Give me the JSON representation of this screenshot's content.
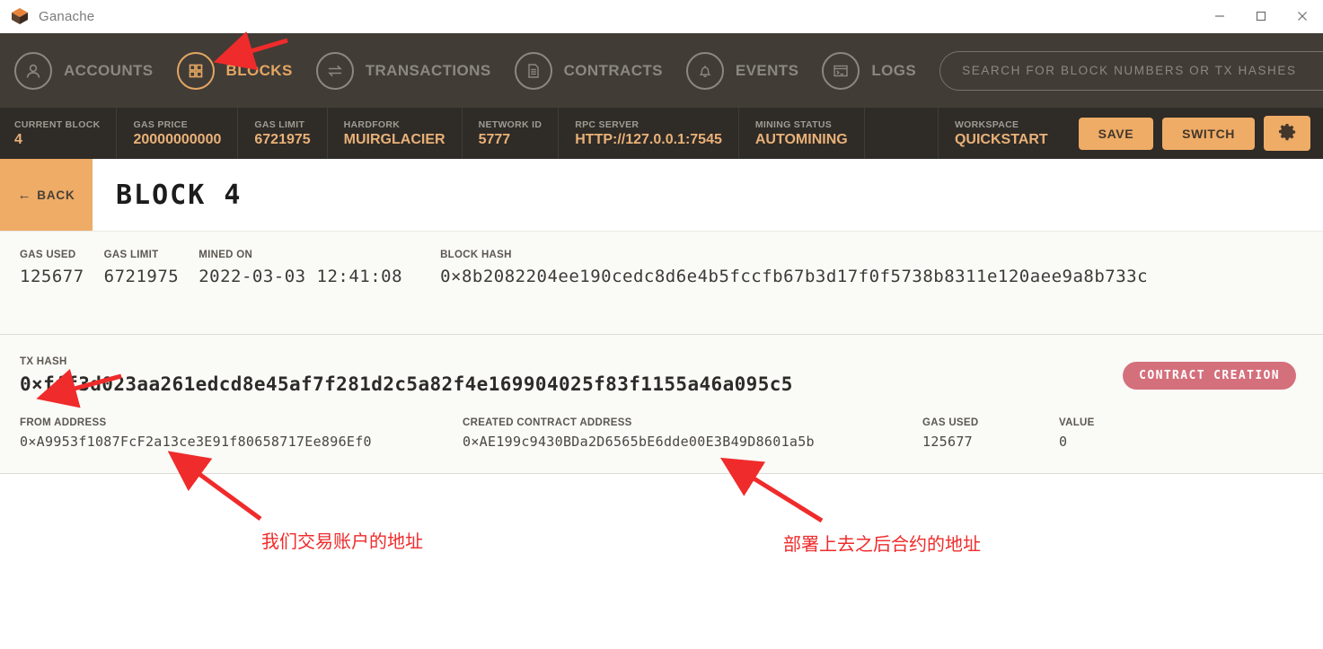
{
  "window": {
    "title": "Ganache",
    "controls": {
      "minimize": "minimize-icon",
      "maximize": "maximize-icon",
      "close": "close-icon"
    }
  },
  "nav": {
    "items": [
      {
        "label": "ACCOUNTS",
        "icon": "user-icon",
        "active": false
      },
      {
        "label": "BLOCKS",
        "icon": "grid-icon",
        "active": true
      },
      {
        "label": "TRANSACTIONS",
        "icon": "exchange-arrows-icon",
        "active": false
      },
      {
        "label": "CONTRACTS",
        "icon": "document-icon",
        "active": false
      },
      {
        "label": "EVENTS",
        "icon": "bell-icon",
        "active": false
      },
      {
        "label": "LOGS",
        "icon": "terminal-window-icon",
        "active": false
      }
    ],
    "search": {
      "placeholder": "SEARCH FOR BLOCK NUMBERS OR TX HASHES",
      "value": "",
      "icon": "search-icon"
    }
  },
  "status": {
    "stats": [
      {
        "label": "CURRENT BLOCK",
        "value": "4"
      },
      {
        "label": "GAS PRICE",
        "value": "20000000000"
      },
      {
        "label": "GAS LIMIT",
        "value": "6721975"
      },
      {
        "label": "HARDFORK",
        "value": "MUIRGLACIER"
      },
      {
        "label": "NETWORK ID",
        "value": "5777"
      },
      {
        "label": "RPC SERVER",
        "value": "HTTP://127.0.0.1:7545"
      },
      {
        "label": "MINING STATUS",
        "value": "AUTOMINING"
      }
    ],
    "workspace": {
      "label": "WORKSPACE",
      "value": "QUICKSTART"
    },
    "save_label": "SAVE",
    "switch_label": "SWITCH",
    "settings_icon": "gear-icon"
  },
  "page": {
    "back_label": "BACK",
    "back_arrow": "←",
    "title": "BLOCK  4"
  },
  "block_summary": {
    "gas_used": {
      "label": "GAS USED",
      "value": "125677"
    },
    "gas_limit": {
      "label": "GAS LIMIT",
      "value": "6721975"
    },
    "mined_on": {
      "label": "MINED ON",
      "value": "2022-03-03 12:41:08"
    },
    "block_hash": {
      "label": "BLOCK HASH",
      "value": "0×8b2082204ee190cedc8d6e4b5fccfb67b3d17f0f5738b8311e120aee9a8b733c"
    }
  },
  "transaction": {
    "tx_hash": {
      "label": "TX HASH",
      "value": "0×fff3d023aa261edcd8e45af7f281d2c5a82f4e169904025f83f1155a46a095c5"
    },
    "badge": "CONTRACT CREATION",
    "from_address": {
      "label": "FROM ADDRESS",
      "value": "0×A9953f1087FcF2a13ce3E91f80658717Ee896Ef0"
    },
    "created_contract_address": {
      "label": "CREATED CONTRACT ADDRESS",
      "value": "0×AE199c9430BDa2D6565bE6dde00E3B49D8601a5b"
    },
    "gas_used": {
      "label": "GAS USED",
      "value": "125677"
    },
    "value": {
      "label": "VALUE",
      "value": "0"
    }
  },
  "annotations": {
    "color": "#ef2b2b",
    "notes": [
      {
        "text": "我们交易账户的地址"
      },
      {
        "text": "部署上去之后合约的地址"
      }
    ]
  }
}
